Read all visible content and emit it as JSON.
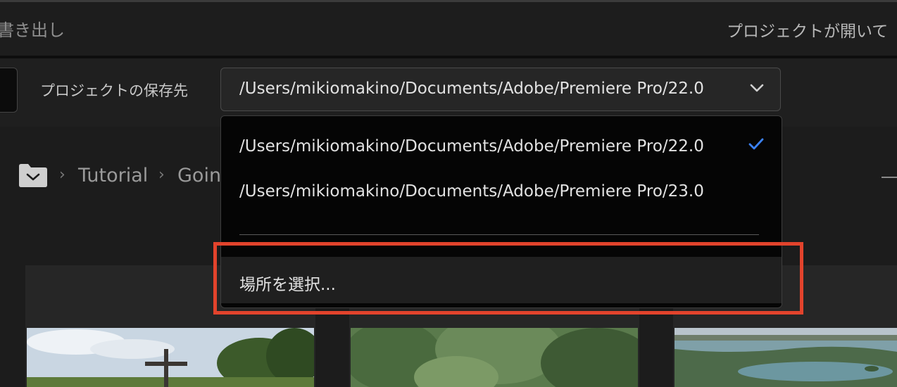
{
  "header": {
    "left_title": "書き出し",
    "right_text": "プロジェクトが開いて"
  },
  "toolbar": {
    "location_label": "プロジェクトの保存先",
    "location_value": "/Users/mikiomakino/Documents/Adobe/Premiere Pro/22.0"
  },
  "dropdown": {
    "options": [
      {
        "label": "/Users/mikiomakino/Documents/Adobe/Premiere Pro/22.0",
        "selected": true
      },
      {
        "label": "/Users/mikiomakino/Documents/Adobe/Premiere Pro/23.0",
        "selected": false
      }
    ],
    "choose_label": "場所を選択..."
  },
  "breadcrumb": {
    "items": [
      "Tutorial",
      "Goin"
    ]
  },
  "colors": {
    "highlight": "#e2432c",
    "check": "#3b82f6"
  }
}
